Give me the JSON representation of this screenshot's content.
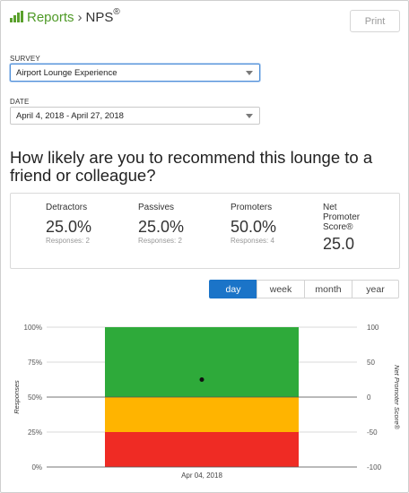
{
  "header": {
    "reports_label": "Reports",
    "separator": "›",
    "current": "NPS",
    "reg_mark": "®"
  },
  "print_label": "Print",
  "survey": {
    "label": "SURVEY",
    "value": "Airport Lounge Experience"
  },
  "date": {
    "label": "DATE",
    "value": "April 4, 2018 - April 27, 2018"
  },
  "question": "How likely are you to recommend this lounge to a friend or colleague?",
  "stats": {
    "detractors": {
      "label": "Detractors",
      "value": "25.0%",
      "sub": "Responses: 2"
    },
    "passives": {
      "label": "Passives",
      "value": "25.0%",
      "sub": "Responses: 2"
    },
    "promoters": {
      "label": "Promoters",
      "value": "50.0%",
      "sub": "Responses: 4"
    },
    "nps": {
      "label_line1": "Net",
      "label_line2": "Promoter",
      "label_line3": "Score®",
      "value": "25.0"
    }
  },
  "granularity": {
    "options": [
      "day",
      "week",
      "month",
      "year"
    ],
    "selected": "day"
  },
  "colors": {
    "promoters": "#2eaa3a",
    "passives": "#ffb400",
    "detractors": "#ef2b24",
    "accent": "#1b74c8",
    "brand_green": "#4f9a27"
  },
  "chart_data": {
    "type": "bar",
    "stacked": true,
    "categories": [
      "Apr 04, 2018"
    ],
    "series": [
      {
        "name": "Detractors",
        "values": [
          25
        ]
      },
      {
        "name": "Passives",
        "values": [
          25
        ]
      },
      {
        "name": "Promoters",
        "values": [
          50
        ]
      }
    ],
    "overlay": {
      "name": "Net Promoter Score®",
      "type": "scatter",
      "values": [
        25
      ]
    },
    "ylabel": "Responses",
    "y2label": "Net Promoter Score®",
    "ylim": [
      0,
      100
    ],
    "y2lim": [
      -100,
      100
    ],
    "yticks": [
      "0%",
      "25%",
      "50%",
      "75%",
      "100%"
    ],
    "y2ticks": [
      "-100",
      "-50",
      "0",
      "50",
      "100"
    ]
  }
}
